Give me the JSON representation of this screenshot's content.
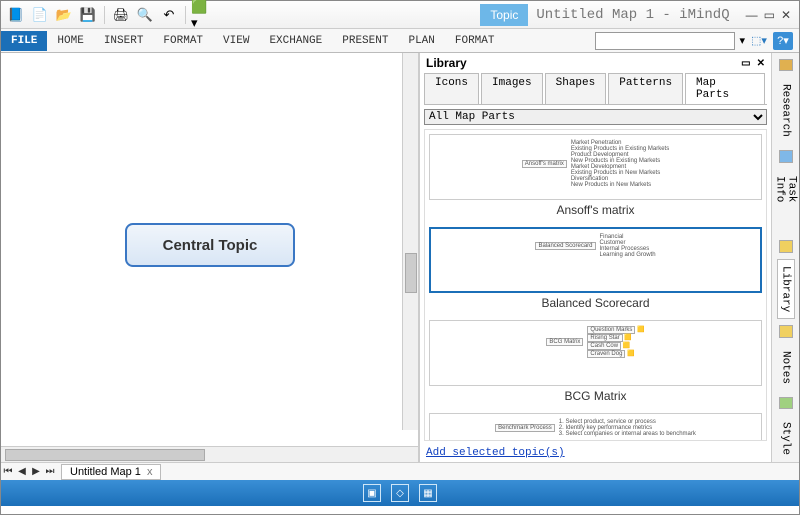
{
  "title": {
    "tab": "Topic",
    "text": "Untitled Map 1 - iMindQ"
  },
  "ribbon": {
    "file": "FILE",
    "tabs": [
      "HOME",
      "INSERT",
      "FORMAT",
      "VIEW",
      "EXCHANGE",
      "PRESENT",
      "PLAN",
      "FORMAT"
    ]
  },
  "canvas": {
    "central": "Central Topic"
  },
  "doc_tab": {
    "label": "Untitled Map 1",
    "close": "x"
  },
  "library": {
    "title": "Library",
    "tabs": [
      "Icons",
      "Images",
      "Shapes",
      "Patterns",
      "Map Parts"
    ],
    "active_tab": 4,
    "filter": "All Map Parts",
    "items": [
      {
        "caption": "Ansoff's matrix",
        "root": "Ansoff's matrix",
        "nodes": [
          "Market Penetration",
          "Existing Products in Existing Markets",
          "Product Development",
          "New Products in Existing Markets",
          "Market Development",
          "Existing Products in New Markets",
          "Diversification",
          "New Products in New Markets"
        ]
      },
      {
        "caption": "Balanced Scorecard",
        "root": "Balanced Scorecard",
        "nodes": [
          "Financial",
          "Customer",
          "Internal Processes",
          "Learning and Growth"
        ],
        "selected": true
      },
      {
        "caption": "BCG Matrix",
        "root": "BCG Matrix",
        "nodes": [
          "Question Marks",
          "Rising Star",
          "Cash Cow",
          "Craven Dog"
        ]
      },
      {
        "caption": "",
        "root": "Benchmark Process",
        "nodes": [
          "1. Select product, service or process",
          "2. Identify key performance metrics",
          "3. Select companies or internal areas to benchmark"
        ]
      }
    ],
    "footer_link": "Add selected topic(s)"
  },
  "side_tabs": [
    "Research",
    "Task Info",
    "Library",
    "Notes",
    "Style"
  ]
}
